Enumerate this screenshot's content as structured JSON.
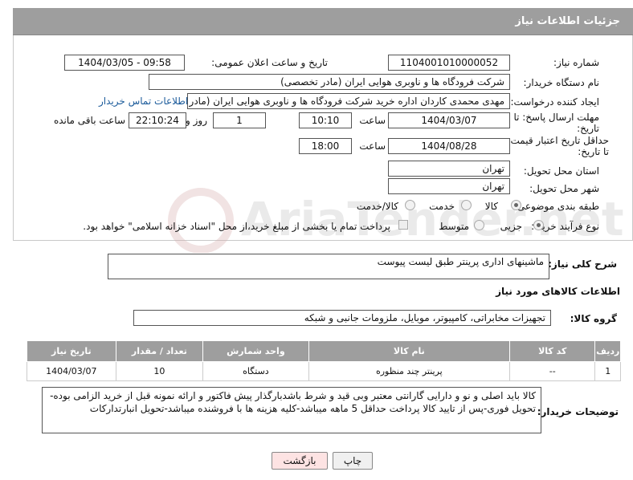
{
  "header": {
    "title": "جزئیات اطلاعات نیاز"
  },
  "fields": {
    "need_number_label": "شماره نیاز:",
    "need_number": "1104001010000052",
    "announce_label": "تاریخ و ساعت اعلان عمومی:",
    "announce_value": "1404/03/05 - 09:58",
    "buyer_org_label": "نام دستگاه خریدار:",
    "buyer_org": "شرکت فرودگاه ها و ناوبری هوایی ایران (مادر تخصصی)",
    "creator_label": "ایجاد کننده درخواست:",
    "creator": "مهدی محمدی کاردان اداره خرید شرکت فرودگاه ها و ناوبری هوایی ایران (مادر تخ",
    "contact_link": "اطلاعات تماس خریدار",
    "deadline_label_1": "مهلت ارسال پاسخ: تا",
    "deadline_label_2": "تاریخ:",
    "deadline_date": "1404/03/07",
    "time_label": "ساعت",
    "deadline_time": "10:10",
    "days_value": "1",
    "days_label": "روز و",
    "remaining_time": "22:10:24",
    "remaining_label": "ساعت باقی مانده",
    "validity_label_1": "حداقل تاریخ اعتبار قیمت:",
    "validity_label_2": "تا تاریخ:",
    "validity_date": "1404/08/28",
    "validity_time_label": "ساعت",
    "validity_time": "18:00",
    "province_label": "استان محل تحویل:",
    "province": "تهران",
    "city_label": "شهر محل تحویل:",
    "city": "تهران",
    "category_label": "طبقه بندی موضوعی:",
    "category_options": [
      "کالا",
      "خدمت",
      "کالا/خدمت"
    ],
    "process_label": "نوع فرآیند خرید :",
    "process_options": [
      "جزیی",
      "متوسط"
    ],
    "payment_note": "پرداخت تمام یا بخشی از مبلغ خرید،از محل \"اسناد خزانه اسلامی\" خواهد بود."
  },
  "summary": {
    "label": "شرح کلی نیاز:",
    "value": "ماشینهای اداری پرینتر طبق لیست پیوست"
  },
  "goods": {
    "section_title": "اطلاعات کالاهای مورد نیاز",
    "group_label": "گروه کالا:",
    "group_value": "تجهیزات مخابراتی، کامپیوتر، موبایل، ملزومات جانبی و شبکه",
    "columns": [
      "ردیف",
      "کد کالا",
      "نام کالا",
      "واحد شمارش",
      "تعداد / مقدار",
      "تاریخ نیاز"
    ],
    "rows": [
      {
        "row": "1",
        "code": "--",
        "name": "پرینتر چند منظوره",
        "unit": "دستگاه",
        "qty": "10",
        "date": "1404/03/07"
      }
    ]
  },
  "notes": {
    "label": "توضیحات خریدار:",
    "value": "کالا باید اصلی و نو و دارایی گارانتی معتبر وبی قید و شرط باشدبارگذار پیش فاکتور و ارائه نمونه قبل از خرید الزامی بوده-تحویل فوری-پس از تایید کالا پرداخت حداقل 5 ماهه میباشد-کلیه هزینه ها با فروشنده میباشد-تحویل انبارتدارکات"
  },
  "buttons": {
    "print": "چاپ",
    "back": "بازگشت"
  },
  "watermark": "AriaTender.net",
  "colors": {
    "header": "#9e9e9e",
    "link": "#1a5a9a",
    "back_button": "#fde3e3"
  }
}
